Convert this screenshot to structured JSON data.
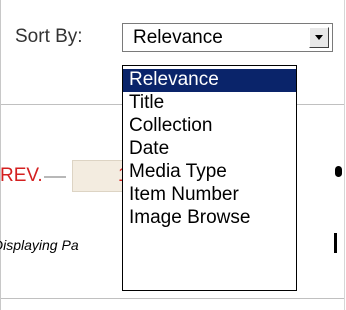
{
  "sort": {
    "label": "Sort By:",
    "selected_value": "Relevance",
    "options": [
      "Relevance",
      "Title",
      "Collection",
      "Date",
      "Media Type",
      "Item Number",
      "Image Browse"
    ],
    "highlighted_index": 0
  },
  "pagination": {
    "prev_label": "REV.",
    "current_page_partial": "1",
    "status_text": "Displaying Pa"
  },
  "colors": {
    "highlight_bg": "#0a246a",
    "highlight_text": "#ffffff",
    "link_red": "#d42020",
    "page_box_bg": "#f3ece0"
  },
  "icons": {
    "dropdown_arrow": "chevron-down-icon"
  }
}
